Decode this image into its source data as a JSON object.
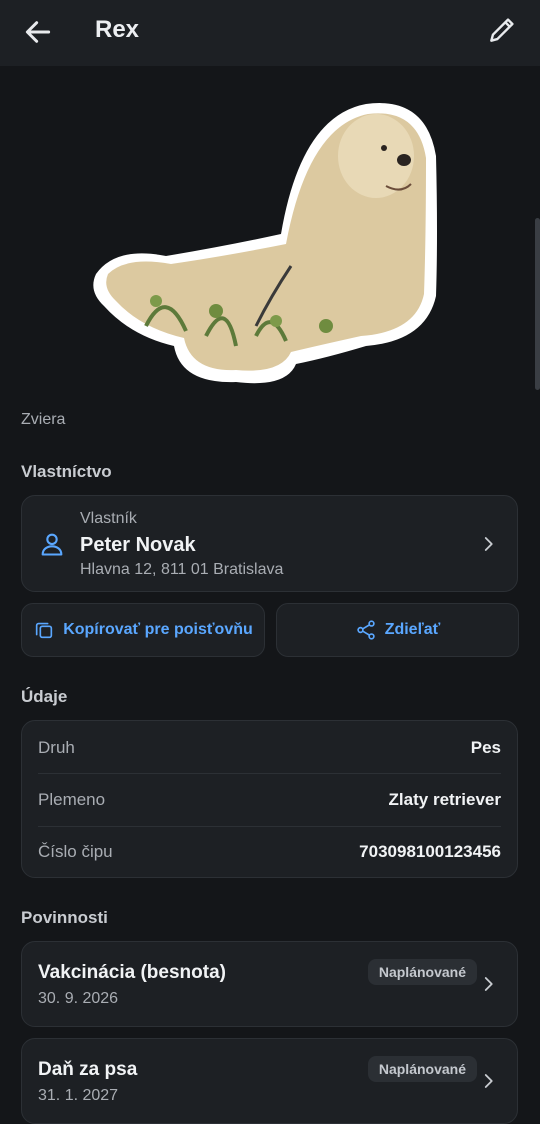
{
  "header": {
    "title": "Rex"
  },
  "pet": {
    "caption": "Zviera"
  },
  "ownership": {
    "section_title": "Vlastníctvo",
    "owner_label": "Vlastník",
    "owner_name": "Peter Novak",
    "owner_address": "Hlavna 12, 811 01 Bratislava"
  },
  "actions": {
    "copy_label": "Kopírovať pre poisťovňu",
    "share_label": "Zdieľať"
  },
  "details": {
    "section_title": "Údaje",
    "rows": [
      {
        "label": "Druh",
        "value": "Pes"
      },
      {
        "label": "Plemeno",
        "value": "Zlaty retriever"
      },
      {
        "label": "Číslo čipu",
        "value": "703098100123456"
      }
    ]
  },
  "duties": {
    "section_title": "Povinnosti",
    "items": [
      {
        "title": "Vakcinácia (besnota)",
        "date": "30. 9. 2026",
        "status": "Naplánované"
      },
      {
        "title": "Daň za psa",
        "date": "31. 1. 2027",
        "status": "Naplánované"
      }
    ]
  },
  "colors": {
    "accent": "#5aa7ff",
    "background": "#141619",
    "card": "#1d2024"
  },
  "icons": [
    "back-arrow-icon",
    "edit-pencil-icon",
    "person-icon",
    "chevron-right-icon",
    "copy-icon",
    "share-icon"
  ]
}
